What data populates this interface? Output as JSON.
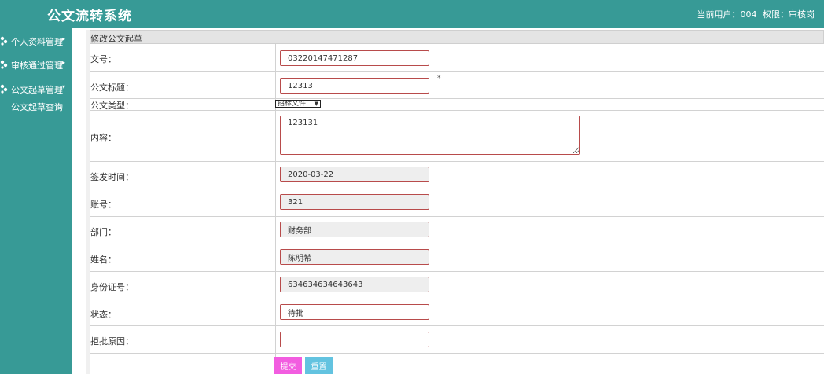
{
  "app": {
    "title": "公文流转系统",
    "user_label": "当前用户：004",
    "role_label": "权限：审核岗"
  },
  "sidebar": {
    "items": [
      {
        "label": "个人资料管理",
        "icon": "users-icon",
        "arrow": "▸"
      },
      {
        "label": "审核通过管理",
        "icon": "users-icon",
        "arrow": "▸"
      },
      {
        "label": "公文起草管理",
        "icon": "users-icon",
        "arrow": "▾"
      }
    ],
    "subitems": [
      {
        "label": "公文起草查询"
      }
    ]
  },
  "form": {
    "heading": "修改公文起草",
    "fields": {
      "doc_no": {
        "label": "文号：",
        "value": "03220147471287"
      },
      "doc_title": {
        "label": "公文标题：",
        "value": "12313",
        "required_mark": "*"
      },
      "doc_type": {
        "label": "公文类型：",
        "value": "招标文件"
      },
      "content": {
        "label": "内容：",
        "value": "123131"
      },
      "issue_date": {
        "label": "签发时间：",
        "value": "2020-03-22"
      },
      "account": {
        "label": "账号：",
        "value": "321"
      },
      "department": {
        "label": "部门：",
        "value": "财务部"
      },
      "name": {
        "label": "姓名：",
        "value": "陈明希"
      },
      "id_number": {
        "label": "身份证号：",
        "value": "634634634643643"
      },
      "status": {
        "label": "状态：",
        "value": "待批"
      },
      "reject_reason": {
        "label": "拒批原因：",
        "value": ""
      }
    },
    "buttons": {
      "submit": "提交",
      "reset": "重置"
    }
  },
  "colors": {
    "brand": "#379a96",
    "field_border": "#b84b4b",
    "submit": "#f25de0",
    "reset": "#63c3e0"
  }
}
